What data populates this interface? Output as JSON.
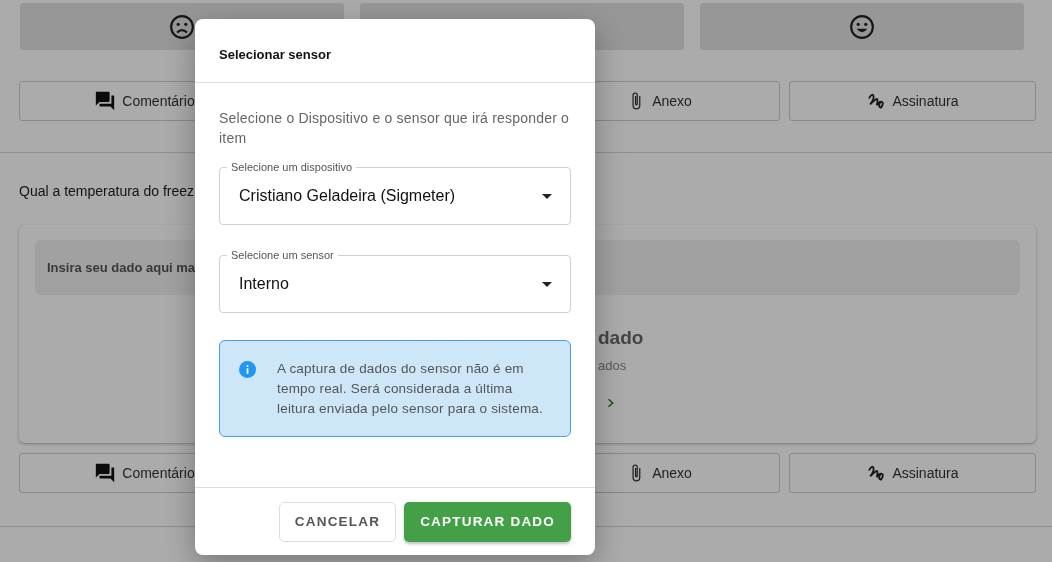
{
  "background": {
    "action_rows": [
      [
        {
          "kind": "comment",
          "label": "Comentário"
        },
        {
          "kind": "hidden"
        },
        {
          "kind": "attachment",
          "label": "Anexo"
        },
        {
          "kind": "signature",
          "label": "Assinatura"
        }
      ],
      [
        {
          "kind": "comment",
          "label": "Comentário"
        },
        {
          "kind": "hidden"
        },
        {
          "kind": "attachment",
          "label": "Anexo"
        },
        {
          "kind": "signature",
          "label": "Assinatura"
        }
      ]
    ],
    "question": "Qual a temperatura do freez",
    "input_hint": "Insira seu dado aqui ma",
    "empty_title": "dado",
    "empty_subtitle": "ados"
  },
  "dialog": {
    "title": "Selecionar sensor",
    "description": "Selecione o Dispositivo e o sensor que irá responder o item",
    "selects": [
      {
        "label": "Selecione um dispositivo",
        "value": "Cristiano Geladeira (Sigmeter)"
      },
      {
        "label": "Selecione um sensor",
        "value": "Interno"
      }
    ],
    "alert": "A captura de dados do sensor não é em tempo real. Será considerada a última leitura enviada pelo sensor para o sistema.",
    "buttons": [
      {
        "kind": "secondary",
        "label": "CANCELAR"
      },
      {
        "kind": "primary",
        "label": "CAPTURAR DADO"
      }
    ]
  }
}
